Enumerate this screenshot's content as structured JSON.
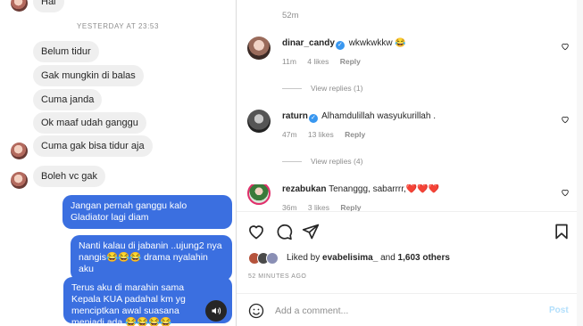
{
  "chat": {
    "first_message": "Hai",
    "date_separator": "YESTERDAY AT 23:53",
    "incoming": [
      "Belum tidur",
      "Gak mungkin di balas",
      "Cuma janda",
      "Ok maaf udah ganggu",
      "Cuma gak bisa tidur aja",
      "Boleh vc gak"
    ],
    "outgoing": [
      "Jangan pernah ganggu kalo Gladiator lagi diam",
      "Nanti kalau di jabanin ..ujung2 nya nangis😂😂😂 drama nyalahin aku",
      "Terus aku di marahin sama Kepala KUA padahal km yg menciptkan awal suasana menjadi ada 😂😂😂😂"
    ]
  },
  "comments_panel": {
    "top_time": "52m",
    "comments": [
      {
        "username": "dinar_candy",
        "verified": true,
        "text": "wkwkwkkw 😂",
        "time": "11m",
        "likes": "4 likes",
        "reply": "Reply",
        "view_replies": "View replies (1)"
      },
      {
        "username": "raturn",
        "verified": true,
        "text": "Alhamdulillah wasyukurillah .",
        "time": "47m",
        "likes": "13 likes",
        "reply": "Reply",
        "view_replies": "View replies (4)"
      },
      {
        "username": "rezabukan",
        "verified": false,
        "text": "Tenanggg, sabarrrr,❤️❤️❤️",
        "time": "36m",
        "likes": "3 likes",
        "reply": "Reply"
      }
    ],
    "liked_by_prefix": "Liked by ",
    "liked_by_user": "evabelisima_",
    "liked_by_and": " and ",
    "liked_by_others": "1,603 others",
    "post_time": "52 MINUTES AGO",
    "add_comment_placeholder": "Add a comment...",
    "post_label": "Post"
  },
  "icons": {
    "like": "heart-icon",
    "comment": "comment-icon",
    "share": "send-icon",
    "save": "bookmark-icon",
    "emoji": "emoji-icon",
    "speaker": "speaker-icon"
  },
  "colors": {
    "outgoing_bubble": "#3b6fe0",
    "incoming_bubble": "#efefef",
    "verified_badge": "#3897f0",
    "post_button_disabled": "#b2dffc"
  }
}
